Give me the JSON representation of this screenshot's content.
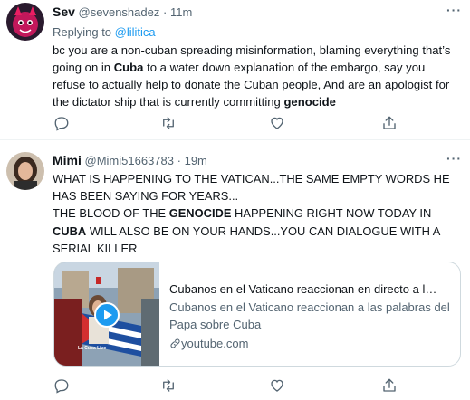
{
  "tweets": [
    {
      "name": "Sev",
      "handle": "@sevenshadez",
      "sep": "·",
      "time": "11m",
      "replying_prefix": "Replying to ",
      "replying_to": "@lilitica",
      "more_label": "···",
      "text": {
        "p1": "bc you are a non-cuban spreading misinformation, blaming everything that’s going on in ",
        "b1": "Cuba",
        "p2": " to a water down explanation of the embargo, say you refuse to actually help to donate the Cuban people, And are an apologist for the dictator ship that is currently committing ",
        "b2": "genocide"
      }
    },
    {
      "name": "Mimi",
      "handle": "@Mimi51663783",
      "sep": "·",
      "time": "19m",
      "more_label": "···",
      "text": {
        "p1": "WHAT IS HAPPENING TO THE VATICAN...THE SAME EMPTY WORDS HE HAS BEEN SAYING FOR YEARS...",
        "p2": "THE BLOOD OF THE ",
        "b1": "GENOCIDE",
        "p3": " HAPPENING RIGHT NOW TODAY IN ",
        "b2": "CUBA",
        "p4": " WILL ALSO BE ON YOUR HANDS...YOU CAN DIALOGUE WITH A SERIAL KILLER"
      },
      "card": {
        "title": "Cubanos en el Vaticano reaccionan en directo a l…",
        "description": "Cubanos en el Vaticano reaccionan a las palabras del Papa sobre Cuba",
        "domain": "youtube.com",
        "thumb_caption": "La Cuba Live"
      }
    }
  ],
  "icons": [
    "reply-icon",
    "retweet-icon",
    "like-icon",
    "share-icon",
    "more-icon",
    "link-icon",
    "play-icon"
  ],
  "colors": {
    "accent": "#1d9bf0",
    "secondary_text": "#536471",
    "border": "#cfd9de",
    "play": "#1d9bf0"
  }
}
